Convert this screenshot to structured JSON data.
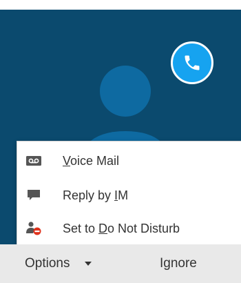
{
  "call": {
    "accent_color": "#16a3f0",
    "background_color": "#0b4a6e",
    "call_icon": "phone-icon",
    "avatar_icon": "person-silhouette-icon"
  },
  "menu": {
    "items": [
      {
        "icon": "voicemail-icon",
        "label_pre": "",
        "label_key": "V",
        "label_post": "oice Mail"
      },
      {
        "icon": "chat-bubble-icon",
        "label_pre": "Reply by ",
        "label_key": "I",
        "label_post": "M"
      },
      {
        "icon": "do-not-disturb-icon",
        "label_pre": "Set to ",
        "label_key": "D",
        "label_post": "o Not Disturb"
      }
    ]
  },
  "footer": {
    "options_label": "Options",
    "options_icon": "caret-down-icon",
    "ignore_label": "Ignore"
  }
}
